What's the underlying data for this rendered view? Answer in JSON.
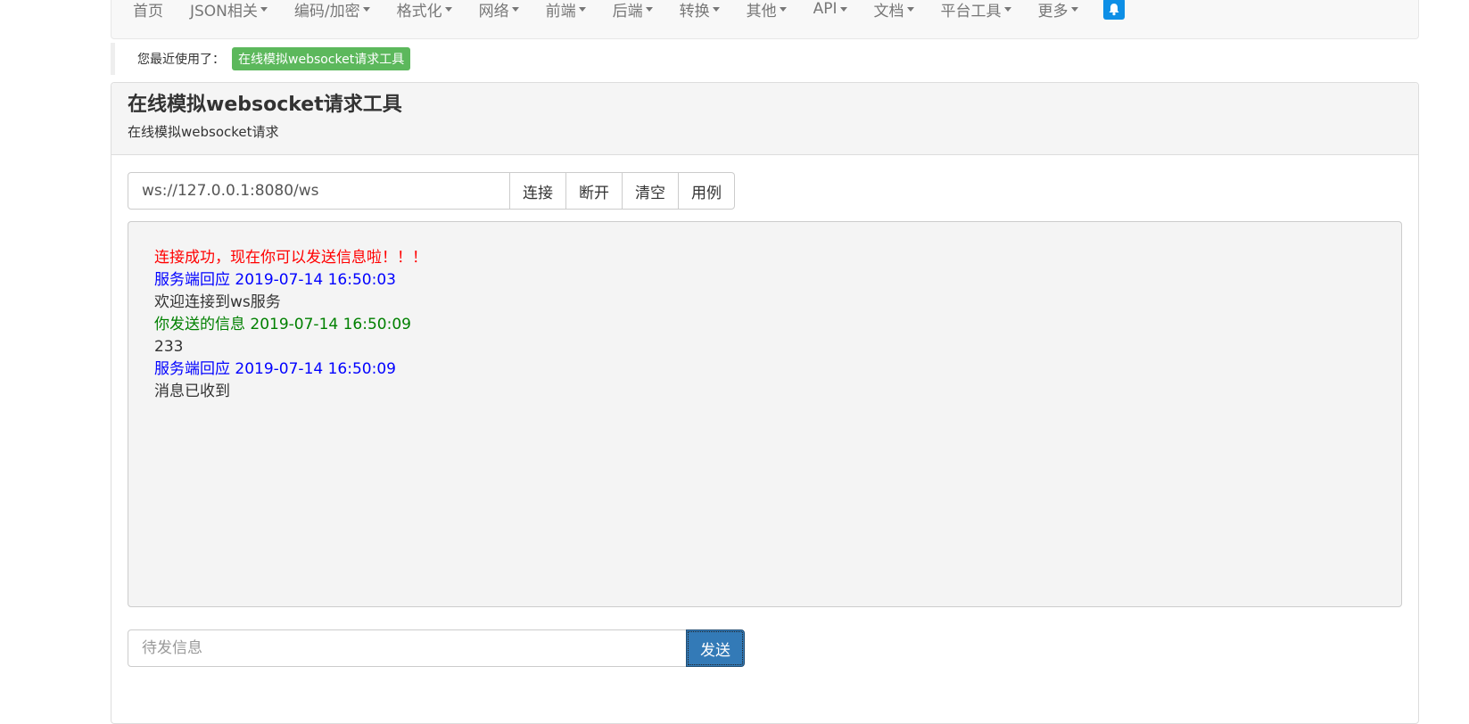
{
  "nav": {
    "items": [
      {
        "label": "首页",
        "dropdown": false
      },
      {
        "label": "JSON相关",
        "dropdown": true
      },
      {
        "label": "编码/加密",
        "dropdown": true
      },
      {
        "label": "格式化",
        "dropdown": true
      },
      {
        "label": "网络",
        "dropdown": true
      },
      {
        "label": "前端",
        "dropdown": true
      },
      {
        "label": "后端",
        "dropdown": true
      },
      {
        "label": "转换",
        "dropdown": true
      },
      {
        "label": "其他",
        "dropdown": true
      },
      {
        "label": "API",
        "dropdown": true
      },
      {
        "label": "文档",
        "dropdown": true
      },
      {
        "label": "平台工具",
        "dropdown": true
      },
      {
        "label": "更多",
        "dropdown": true
      }
    ],
    "bell_icon": "bell-icon",
    "bell_color": "#0d8fe6"
  },
  "recent": {
    "label": "您最近使用了：",
    "badge": "在线模拟websocket请求工具",
    "badge_color": "#5cb85c"
  },
  "panel": {
    "title": "在线模拟websocket请求工具",
    "subtitle": "在线模拟websocket请求"
  },
  "connection": {
    "url_value": "ws://127.0.0.1:8080/ws",
    "connect_label": "连接",
    "disconnect_label": "断开",
    "clear_label": "清空",
    "example_label": "用例"
  },
  "log": {
    "lines": [
      {
        "text": "连接成功，现在你可以发送信息啦！！！",
        "color": "#ff0000"
      },
      {
        "text": "服务端回应 2019-07-14 16:50:03",
        "color": "#0000ff"
      },
      {
        "text": "欢迎连接到ws服务",
        "color": "#333333"
      },
      {
        "text": "你发送的信息 2019-07-14 16:50:09",
        "color": "#008000"
      },
      {
        "text": "233",
        "color": "#333333"
      },
      {
        "text": "服务端回应 2019-07-14 16:50:09",
        "color": "#0000ff"
      },
      {
        "text": "消息已收到",
        "color": "#333333"
      }
    ]
  },
  "send": {
    "placeholder": "待发信息",
    "value": "",
    "send_label": "发送",
    "send_color": "#337ab7"
  }
}
